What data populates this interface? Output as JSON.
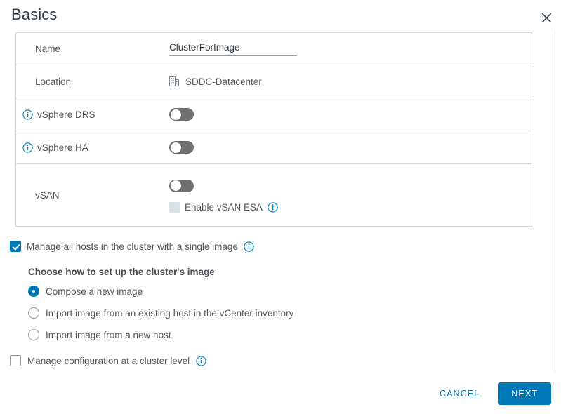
{
  "header": {
    "title": "Basics",
    "close_icon": "close-icon"
  },
  "basics": {
    "rows": [
      {
        "label": "Name",
        "type": "text-input",
        "value": "ClusterForImage",
        "placeholder": ""
      },
      {
        "label": "Location",
        "type": "static",
        "icon": "datacenter-icon",
        "value": "SDDC-Datacenter"
      },
      {
        "label": "vSphere DRS",
        "type": "toggle",
        "info_icon": "info-icon",
        "enabled": false
      },
      {
        "label": "vSphere HA",
        "type": "toggle",
        "info_icon": "info-icon",
        "enabled": false
      },
      {
        "label": "vSAN",
        "type": "toggle-with-checkbox",
        "enabled": false,
        "sub_checkbox_label": "Enable vSAN ESA",
        "sub_checkbox_checked": false,
        "sub_checkbox_disabled": true,
        "sub_info_icon": "info-icon"
      }
    ]
  },
  "image_section": {
    "manage_image_label": "Manage all hosts in the cluster with a single image",
    "manage_image_checked": true,
    "manage_image_info_icon": "info-icon",
    "sub_heading": "Choose how to set up the cluster's image",
    "radio_options": [
      {
        "label": "Compose a new image",
        "selected": true
      },
      {
        "label": "Import image from an existing host in the vCenter inventory",
        "selected": false
      },
      {
        "label": "Import image from a new host",
        "selected": false
      }
    ],
    "cluster_config_label": "Manage configuration at a cluster level",
    "cluster_config_checked": false,
    "cluster_config_info_icon": "info-icon"
  },
  "footer": {
    "cancel_label": "CANCEL",
    "next_label": "NEXT"
  },
  "colors": {
    "accent": "#0079b8",
    "border": "#cdd7dc",
    "text": "#565656",
    "title": "#313b44",
    "toggle_off": "#707070"
  }
}
